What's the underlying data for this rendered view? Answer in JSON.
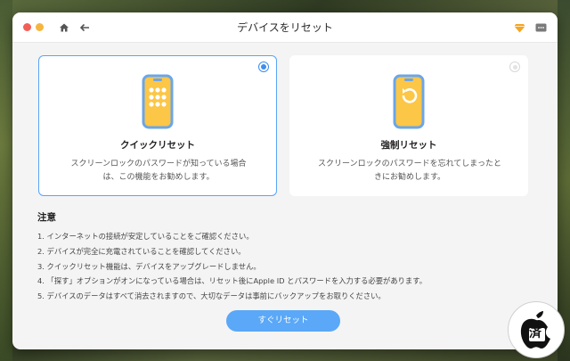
{
  "window": {
    "title": "デバイスをリセット"
  },
  "options": [
    {
      "title": "クイックリセット",
      "description": "スクリーンロックのパスワードが知っている場合は、この機能をお勧めします。",
      "selected": true,
      "icon": "phone-grid-icon"
    },
    {
      "title": "強制リセット",
      "description": "スクリーンロックのパスワードを忘れてしまったときにお勧めします。",
      "selected": false,
      "icon": "phone-reset-icon"
    }
  ],
  "notes": {
    "heading": "注意",
    "items": [
      "1. インターネットの接続が安定していることをご確認ください。",
      "2. デバイスが完全に充電されていることを確認してください。",
      "3. クイックリセット機能は、デバイスをアップグレードしません。",
      "4. 「探す」オプションがオンになっている場合は、リセット後にApple ID とパスワードを入力する必要があります。",
      "5. デバイスのデータはすべて消去されますので、大切なデータは事前にバックアップをお取りください。"
    ]
  },
  "action": {
    "reset_label": "すぐリセット"
  },
  "watermark": {
    "text": "済"
  },
  "colors": {
    "accent": "#3d8ef0",
    "button": "#5aa8f7",
    "icon_fill": "#fcc646",
    "icon_outline": "#6ba6e8"
  }
}
